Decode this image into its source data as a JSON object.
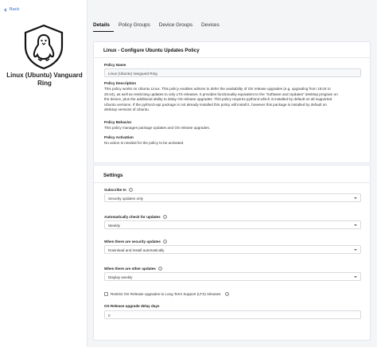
{
  "nav": {
    "back_label": "Back"
  },
  "ring": {
    "title_line1": "Linux (Ubuntu) Vanguard",
    "title_line2": "Ring"
  },
  "tabs": [
    {
      "label": "Details",
      "active": true
    },
    {
      "label": "Policy Groups",
      "active": false
    },
    {
      "label": "Device Groups",
      "active": false
    },
    {
      "label": "Devices",
      "active": false
    }
  ],
  "policy": {
    "heading": "Linux - Configure Ubuntu Updates Policy",
    "name_label": "Policy Name",
    "name_value": "Linux (Ubuntu) Vanguard Ring",
    "description_label": "Policy Description",
    "description_lines": [
      "This policy works on Ubuntu Linux. This policy enables admins to defer the availability of OS release upgrades (e.g. upgrading from 18.04 to",
      "20.04), as well as restricting updates to only LTS releases. It provides functionality equivalent to the \"Software and Updates\" desktop program on",
      "the device, plus the additional ability to delay OS release upgrades. This policy requires python3 which is installed by default on all supported",
      "Ubuntu versions. If the python3-apt package is not already installed this policy will install it, however this package is installed by default on",
      "desktop versions of Ubuntu."
    ],
    "behavior_label": "Policy Behavior",
    "behavior_text": "This policy manages package updates and OS release upgrades.",
    "activation_label": "Policy Activation",
    "activation_text": "No action is needed for the policy to be activated."
  },
  "settings": {
    "heading": "Settings",
    "subscribe_label": "Subscribe to",
    "subscribe_value": "Security updates only",
    "auto_check_label": "Automatically check for updates",
    "auto_check_value": "Weekly",
    "security_label": "When there are security updates",
    "security_value": "Download and install automatically",
    "other_label": "When there are other updates",
    "other_value": "Display weekly",
    "restrict_label": "Restrict OS Release upgrades to Long Term Support (LTS) releases",
    "restrict_checked": false,
    "delay_label": "OS Release upgrade delay days",
    "delay_value": "0"
  },
  "colors": {
    "accent": "#2f6fd6",
    "background": "#f4f5f7"
  },
  "icons": {
    "ring_icon": "linux-tux-shield-icon",
    "info": "info-icon",
    "back": "chevron-left-icon"
  }
}
